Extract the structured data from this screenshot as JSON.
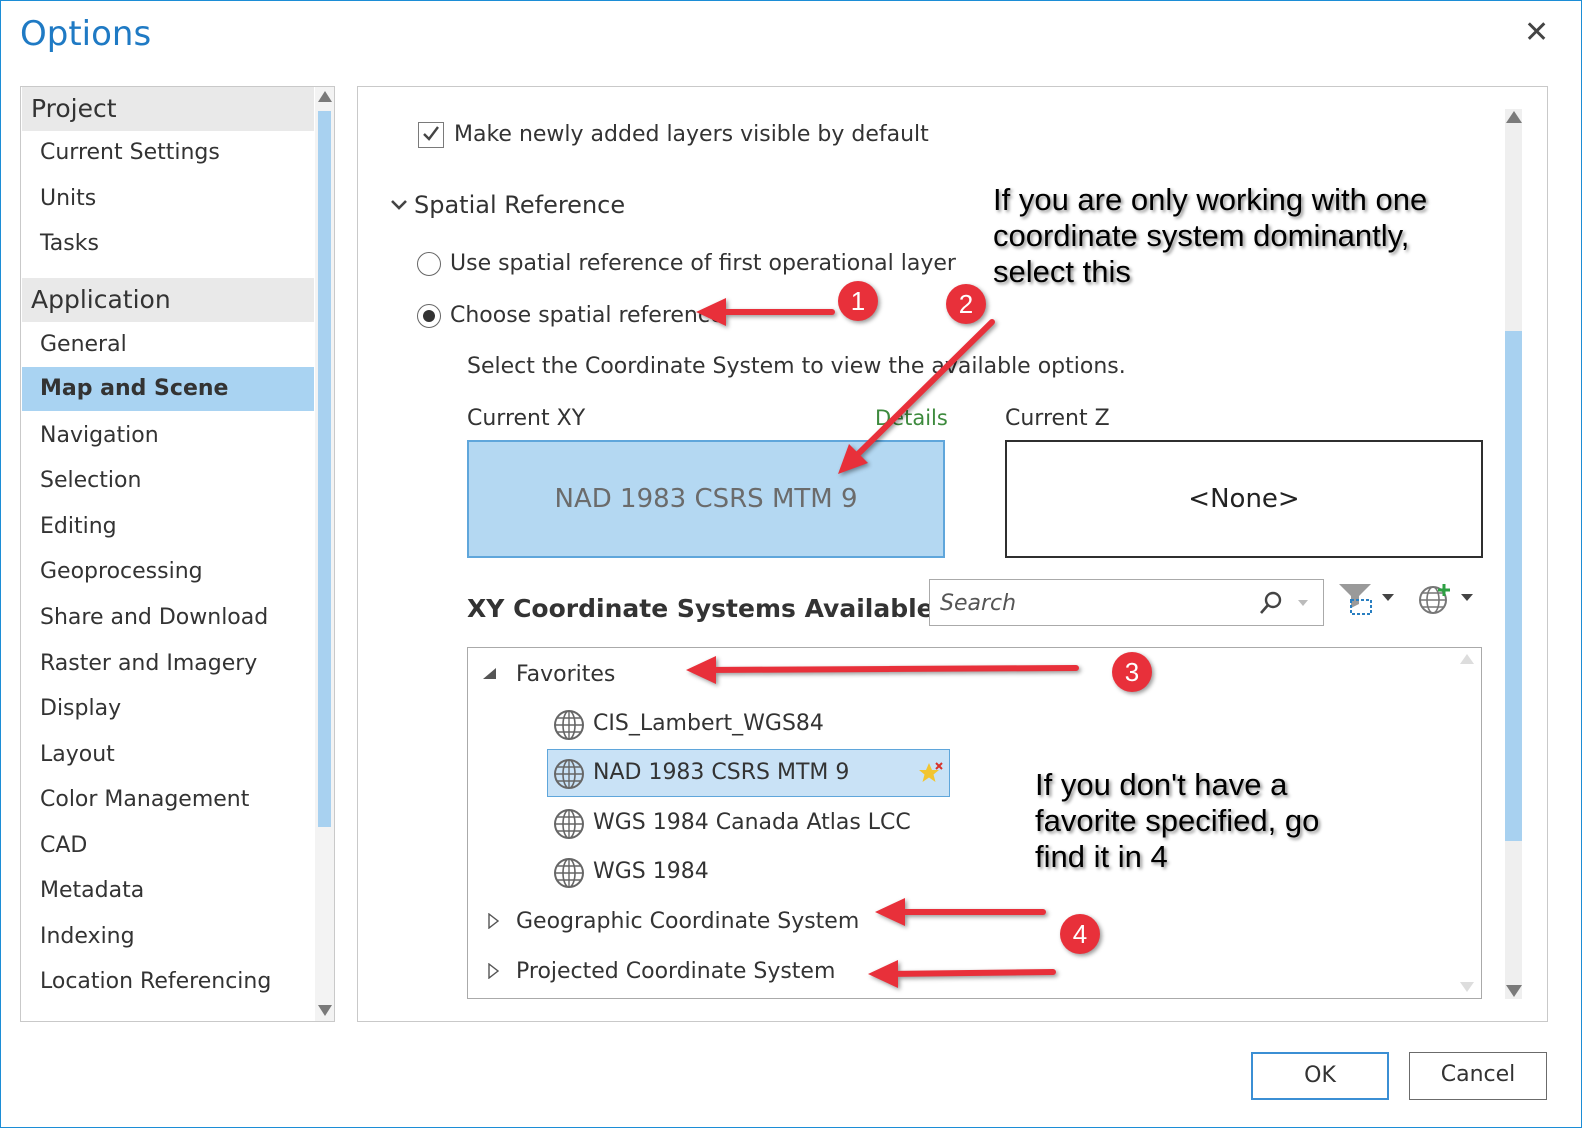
{
  "window": {
    "title": "Options",
    "close_glyph": "✕"
  },
  "nav": {
    "groups": [
      {
        "label": "Project",
        "items": [
          "Current Settings",
          "Units",
          "Tasks"
        ]
      },
      {
        "label": "Application",
        "items": [
          "General",
          "Map and Scene",
          "Navigation",
          "Selection",
          "Editing",
          "Geoprocessing",
          "Share and Download",
          "Raster and Imagery",
          "Display",
          "Layout",
          "Color Management",
          "CAD",
          "Metadata",
          "Indexing",
          "Location Referencing"
        ]
      }
    ],
    "active_item": "Map and Scene"
  },
  "pane": {
    "visible_checkbox_label": "Make newly added layers visible by default",
    "visible_checkbox_checked": true,
    "section_title": "Spatial Reference",
    "radio_first_layer": "Use spatial reference of first operational layer",
    "radio_choose": "Choose spatial reference",
    "radio_selected": "choose",
    "instruction": "Select the Coordinate System to view the available options.",
    "current_xy_label": "Current XY",
    "details_link": "Details",
    "current_xy_value": "NAD 1983 CSRS MTM  9",
    "current_z_label": "Current Z",
    "current_z_value": "<None>",
    "available_title": "XY Coordinate Systems Available",
    "search_placeholder": "Search",
    "tree": {
      "favorites_label": "Favorites",
      "favorites": [
        "CIS_Lambert_WGS84",
        "NAD 1983 CSRS MTM  9",
        "WGS 1984 Canada Atlas LCC",
        "WGS 1984"
      ],
      "selected_favorite": "NAD 1983 CSRS MTM  9",
      "geographic_label": "Geographic Coordinate System",
      "projected_label": "Projected Coordinate System"
    }
  },
  "callouts": {
    "top_lines": [
      "If you are only working with one",
      "coordinate system dominantly,",
      "select this"
    ],
    "bottom_lines": [
      "If you don't have a",
      "favorite specified, go",
      "find it in 4"
    ],
    "badges": [
      "1",
      "2",
      "3",
      "4"
    ]
  },
  "buttons": {
    "ok": "OK",
    "cancel": "Cancel"
  },
  "colors": {
    "accent": "#1f7ac4",
    "selection": "#a9d3f2",
    "annotation_red": "#e8303a"
  }
}
